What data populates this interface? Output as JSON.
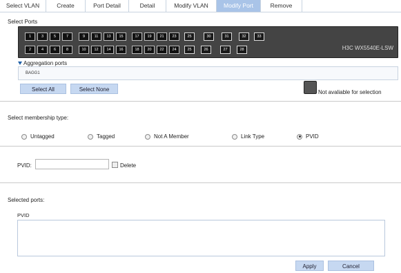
{
  "tabs": [
    {
      "label": "Select VLAN",
      "active": false
    },
    {
      "label": "Create",
      "active": false
    },
    {
      "label": "Port Detail",
      "active": false
    },
    {
      "label": "Detail",
      "active": false
    },
    {
      "label": "Modify VLAN",
      "active": false
    },
    {
      "label": "Modify Port",
      "active": true
    },
    {
      "label": "Remove",
      "active": false
    }
  ],
  "select_ports": {
    "title": "Select Ports",
    "device_model": "H3C WX5540E-LSW",
    "top_ports": [
      "1",
      "3",
      "5",
      "7",
      "9",
      "11",
      "13",
      "15",
      "17",
      "19",
      "21",
      "23",
      "25",
      "30",
      "31",
      "32",
      "33"
    ],
    "bottom_ports": [
      "2",
      "4",
      "6",
      "8",
      "10",
      "12",
      "14",
      "16",
      "18",
      "20",
      "22",
      "24",
      "25",
      "26",
      "27",
      "28"
    ]
  },
  "aggregation": {
    "title": "Aggregation ports",
    "items": [
      "BAGG1"
    ]
  },
  "buttons": {
    "select_all": "Select All",
    "select_none": "Select None",
    "apply": "Apply",
    "cancel": "Cancel"
  },
  "legend": {
    "not_available": "Not avaliable for selection"
  },
  "membership": {
    "title": "Select membership type:",
    "options": [
      "Untagged",
      "Tagged",
      "Not A Member",
      "Link Type",
      "PVID"
    ],
    "selected": "PVID"
  },
  "pvid_form": {
    "label": "PVID:",
    "value": "",
    "delete_label": "Delete",
    "delete_checked": false
  },
  "selected_ports": {
    "title": "Selected ports:",
    "group_label": "PVID",
    "content": ""
  }
}
